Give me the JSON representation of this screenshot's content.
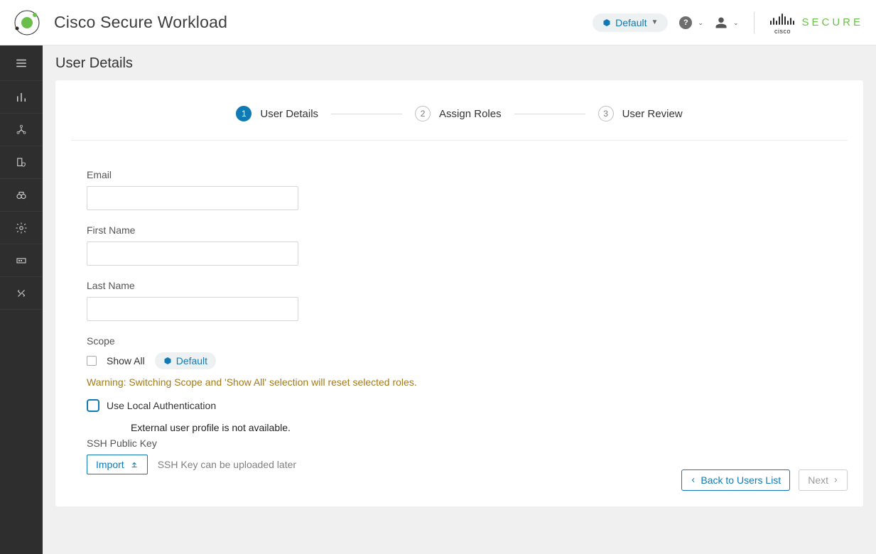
{
  "header": {
    "app_title": "Cisco Secure Workload",
    "scope_pill": "Default",
    "brand_secure": "SECURE",
    "brand_cisco": "cisco"
  },
  "page": {
    "title": "User Details"
  },
  "stepper": {
    "steps": [
      {
        "num": "1",
        "label": "User Details"
      },
      {
        "num": "2",
        "label": "Assign Roles"
      },
      {
        "num": "3",
        "label": "User Review"
      }
    ]
  },
  "form": {
    "email_label": "Email",
    "email_value": "",
    "first_name_label": "First Name",
    "first_name_value": "",
    "last_name_label": "Last Name",
    "last_name_value": "",
    "scope_label": "Scope",
    "show_all_label": "Show All",
    "scope_chip": "Default",
    "warning": "Warning: Switching Scope and 'Show All' selection will reset selected roles.",
    "local_auth_label": "Use Local Authentication",
    "external_profile_msg": "External user profile is not available.",
    "ssh_label": "SSH Public Key",
    "import_btn": "Import",
    "ssh_hint": "SSH Key can be uploaded later"
  },
  "footer": {
    "back_btn": "Back to Users List",
    "next_btn": "Next"
  }
}
